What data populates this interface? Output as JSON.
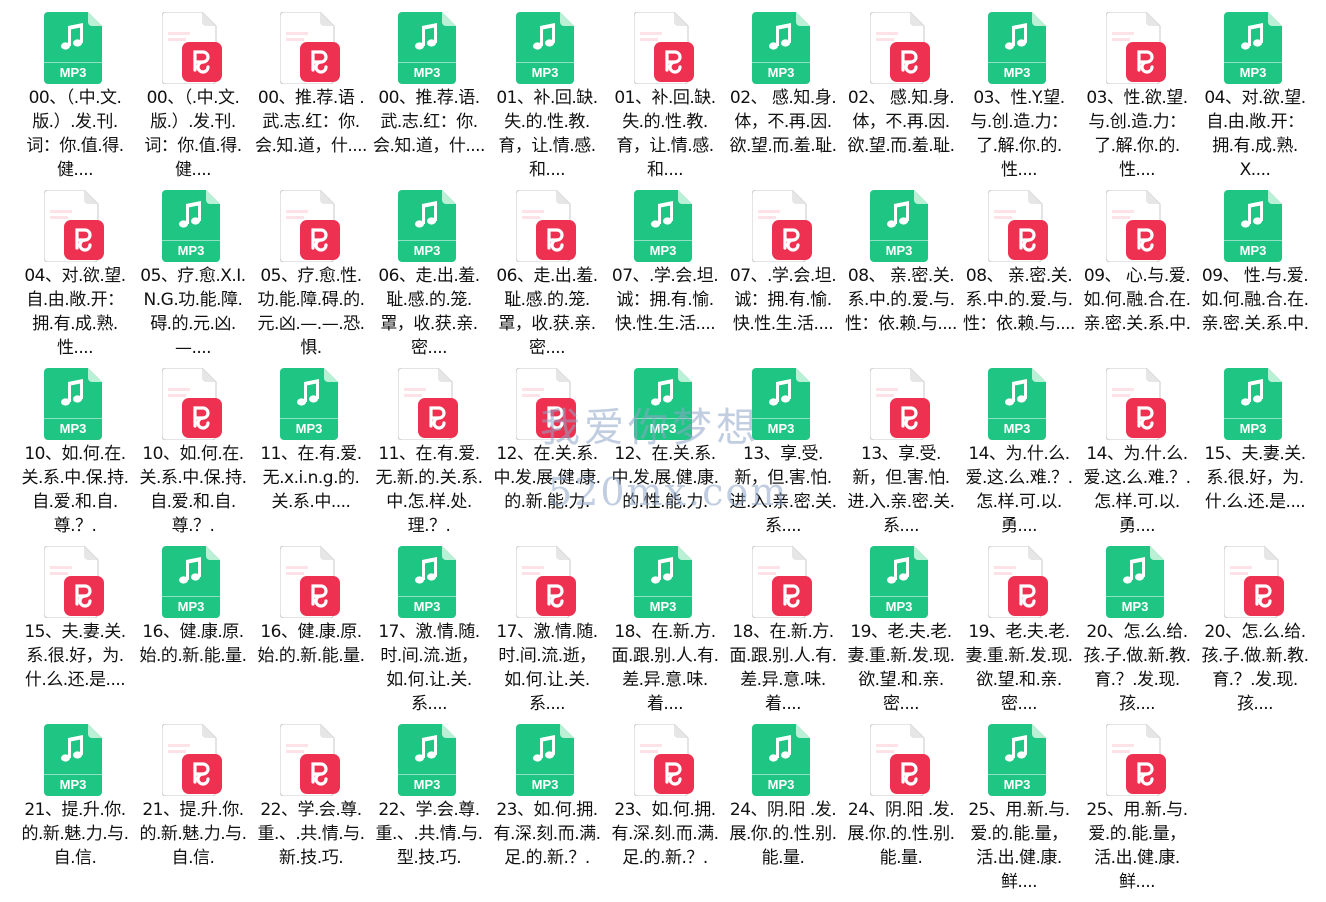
{
  "watermark": {
    "cn": "我爱你梦想",
    "url": "520mx.com",
    "small": "520mx.com"
  },
  "files": [
    {
      "type": "mp3",
      "name": "00、（.中.文.版.）.发.刊.词：你.值.得.健...."
    },
    {
      "type": "pdf",
      "name": "00、（.中.文.版.）.发.刊.词：你.值.得.健...."
    },
    {
      "type": "pdf",
      "name": "00、推.荐.语 .武.志.红：你.会.知.道，什...."
    },
    {
      "type": "mp3",
      "name": "00、推.荐.语.武.志.红：你.会.知.道，什...."
    },
    {
      "type": "mp3",
      "name": "01、补.回.缺.失.的.性.教.育，让.情.感.和...."
    },
    {
      "type": "pdf",
      "name": "01、补.回.缺.失.的.性.教.育，让.情.感.和...."
    },
    {
      "type": "mp3",
      "name": "02、 感.知.身.体，不.再.因.欲.望.而.羞.耻."
    },
    {
      "type": "pdf",
      "name": "02、 感.知.身.体，不.再.因.欲.望.而.羞.耻."
    },
    {
      "type": "mp3",
      "name": "03、性.Y.望.与.创.造.力：了.解.你.的.性...."
    },
    {
      "type": "pdf",
      "name": "03、性.欲.望.与.创.造.力：了.解.你.的.性...."
    },
    {
      "type": "mp3",
      "name": "04、对.欲.望.自.由.敞.开：拥.有.成.熟.X...."
    },
    {
      "type": "pdf",
      "name": "04、对.欲.望.自.由.敞.开：拥.有.成.熟.性...."
    },
    {
      "type": "mp3",
      "name": "05、疗.愈.X.I.N.G.功.能.障.碍.的.元.凶.—...."
    },
    {
      "type": "pdf",
      "name": "05、疗.愈.性.功.能.障.碍.的.元.凶.—.—.恐.惧."
    },
    {
      "type": "mp3",
      "name": "06、走.出.羞.耻.感.的.笼.罩，收.获.亲.密...."
    },
    {
      "type": "pdf",
      "name": "06、走.出.羞.耻.感.的.笼.罩，收.获.亲.密...."
    },
    {
      "type": "mp3",
      "name": "07、.学.会.坦.诚：拥.有.愉.快.性.生.活...."
    },
    {
      "type": "pdf",
      "name": "07、.学.会.坦.诚：拥.有.愉.快.性.生.活...."
    },
    {
      "type": "mp3",
      "name": "08、 亲.密.关.系.中.的.爱.与.性：依.赖.与...."
    },
    {
      "type": "pdf",
      "name": "08、 亲.密.关.系.中.的.爱.与.性：依.赖.与...."
    },
    {
      "type": "pdf",
      "name": "09、 心.与.爱.如.何.融.合.在.亲.密.关.系.中."
    },
    {
      "type": "mp3",
      "name": "09、 性.与.爱.如.何.融.合.在.亲.密.关.系.中."
    },
    {
      "type": "mp3",
      "name": "10、如.何.在.关.系.中.保.持.自.爱.和.自.尊.？."
    },
    {
      "type": "pdf",
      "name": "10、如.何.在.关.系.中.保.持.自.爱.和.自.尊.？."
    },
    {
      "type": "mp3",
      "name": "11、在.有.爱.无.x.i.n.g.的.关.系.中...."
    },
    {
      "type": "pdf",
      "name": "11、在.有.爱.无.新.的.关.系.中.怎.样.处.理.？."
    },
    {
      "type": "pdf",
      "name": "12、在.关.系.中.发.展.健.康.的.新.能.力."
    },
    {
      "type": "mp3",
      "name": "12、在.关.系.中.发.展.健.康.的.性.能.力."
    },
    {
      "type": "mp3",
      "name": "13、享.受.新，但.害.怕.进.入.亲.密.关.系...."
    },
    {
      "type": "pdf",
      "name": "13、享.受.新，但.害.怕.进.入.亲.密.关.系...."
    },
    {
      "type": "mp3",
      "name": "14、为.什.么.爱.这.么.难.？.怎.样.可.以.勇...."
    },
    {
      "type": "pdf",
      "name": "14、为.什.么.爱.这.么.难.？.怎.样.可.以.勇...."
    },
    {
      "type": "mp3",
      "name": "15、夫.妻.关.系.很.好，为.什.么.还.是...."
    },
    {
      "type": "pdf",
      "name": "15、夫.妻.关.系.很.好，为.什.么.还.是...."
    },
    {
      "type": "mp3",
      "name": "16、健.康.原.始.的.新.能.量."
    },
    {
      "type": "pdf",
      "name": "16、健.康.原.始.的.新.能.量."
    },
    {
      "type": "mp3",
      "name": "17、激.情.随.时.间.流.逝，如.何.让.关.系...."
    },
    {
      "type": "pdf",
      "name": "17、激.情.随.时.间.流.逝，如.何.让.关.系...."
    },
    {
      "type": "mp3",
      "name": "18、在.新.方.面.跟.别.人.有.差.异.意.味.着...."
    },
    {
      "type": "pdf",
      "name": "18、在.新.方.面.跟.别.人.有.差.异.意.味.着...."
    },
    {
      "type": "mp3",
      "name": "19、老.夫.老.妻.重.新.发.现.欲.望.和.亲.密...."
    },
    {
      "type": "pdf",
      "name": "19、老.夫.老.妻.重.新.发.现.欲.望.和.亲.密...."
    },
    {
      "type": "mp3",
      "name": "20、怎.么.给.孩.子.做.新.教.育.？.发.现.孩...."
    },
    {
      "type": "pdf",
      "name": "20、怎.么.给.孩.子.做.新.教.育.？.发.现.孩...."
    },
    {
      "type": "mp3",
      "name": "21、提.升.你.的.新.魅.力.与.自.信."
    },
    {
      "type": "pdf",
      "name": "21、提.升.你.的.新.魅.力.与.自.信."
    },
    {
      "type": "pdf",
      "name": "22、学.会.尊.重.、.共.情.与.新.技.巧."
    },
    {
      "type": "mp3",
      "name": "22、学.会.尊.重.、.共.情.与.型.技.巧."
    },
    {
      "type": "mp3",
      "name": "23、如.何.拥.有.深.刻.而.满.足.的.新.？."
    },
    {
      "type": "pdf",
      "name": "23、如.何.拥.有.深.刻.而.满.足.的.新.？."
    },
    {
      "type": "mp3",
      "name": "24、阴.阳 .发.展.你.的.性.别.能.量."
    },
    {
      "type": "pdf",
      "name": "24、阴.阳 .发.展.你.的.性.别.能.量."
    },
    {
      "type": "mp3",
      "name": "25、用.新.与.爱.的.能.量，活.出.健.康.鲜...."
    },
    {
      "type": "pdf",
      "name": "25、用.新.与.爱.的.能.量，活.出.健.康.鲜...."
    }
  ],
  "icons": {
    "mp3": {
      "name": "mp3-file-icon",
      "label": "MP3",
      "color": "#1fc583",
      "fold": "#b9f0d6"
    },
    "pdf": {
      "name": "pdf-file-icon",
      "color": "#ee3150",
      "fold": "#fde3e7"
    }
  }
}
